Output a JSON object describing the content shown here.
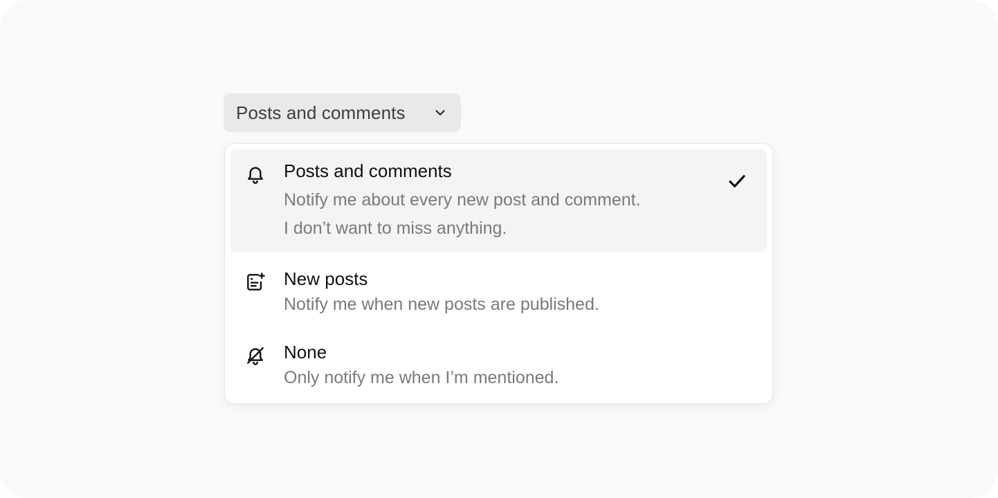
{
  "dropdown": {
    "selected_label": "Posts and comments",
    "trigger_icon": "chevron-down-icon"
  },
  "options": [
    {
      "title": "Posts and comments",
      "description_line1": "Notify me about every new post and comment.",
      "description_line2": "I don’t want to miss anything.",
      "icon": "bell-icon",
      "selected": true
    },
    {
      "title": "New posts",
      "description_line1": "Notify me when new posts are published.",
      "icon": "new-post-icon",
      "selected": false
    },
    {
      "title": "None",
      "description_line1": "Only notify me when I’m mentioned.",
      "icon": "bell-off-icon",
      "selected": false
    }
  ],
  "colors": {
    "background": "#f9f9f9",
    "trigger_bg": "#e9e9e9",
    "selected_bg": "#f4f4f4",
    "title_text": "#111111",
    "description_text": "#7a7a7a"
  }
}
